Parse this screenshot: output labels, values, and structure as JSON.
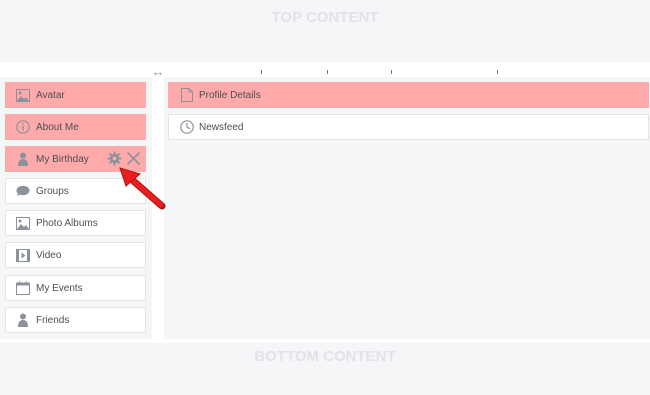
{
  "top_content": {
    "label": "TOP CONTENT"
  },
  "bottom_content": {
    "label": "BOTTOM CONTENT"
  },
  "resize_icon": {
    "glyph": "↔"
  },
  "sidebar": {
    "items": [
      {
        "label": "Avatar",
        "icon": "image-icon",
        "active": true
      },
      {
        "label": "About Me",
        "icon": "info-icon",
        "active": true
      },
      {
        "label": "My Birthday",
        "icon": "person-icon",
        "active": true
      },
      {
        "label": "Groups",
        "icon": "chat-bubble-icon",
        "active": false
      },
      {
        "label": "Photo Albums",
        "icon": "image-icon",
        "active": false
      },
      {
        "label": "Video",
        "icon": "film-icon",
        "active": false
      },
      {
        "label": "My Events",
        "icon": "calendar-icon",
        "active": false
      },
      {
        "label": "Friends",
        "icon": "person-icon",
        "active": false
      }
    ]
  },
  "main": {
    "items": [
      {
        "label": "Profile Details",
        "icon": "document-icon",
        "active": true
      },
      {
        "label": "Newsfeed",
        "icon": "clock-icon",
        "active": false
      }
    ]
  },
  "colors": {
    "active_bg": "#ffaaaa",
    "region_bg": "#f5f6f8",
    "icon_gray": "#8c929b",
    "arrow_red": "#e81f1f"
  }
}
